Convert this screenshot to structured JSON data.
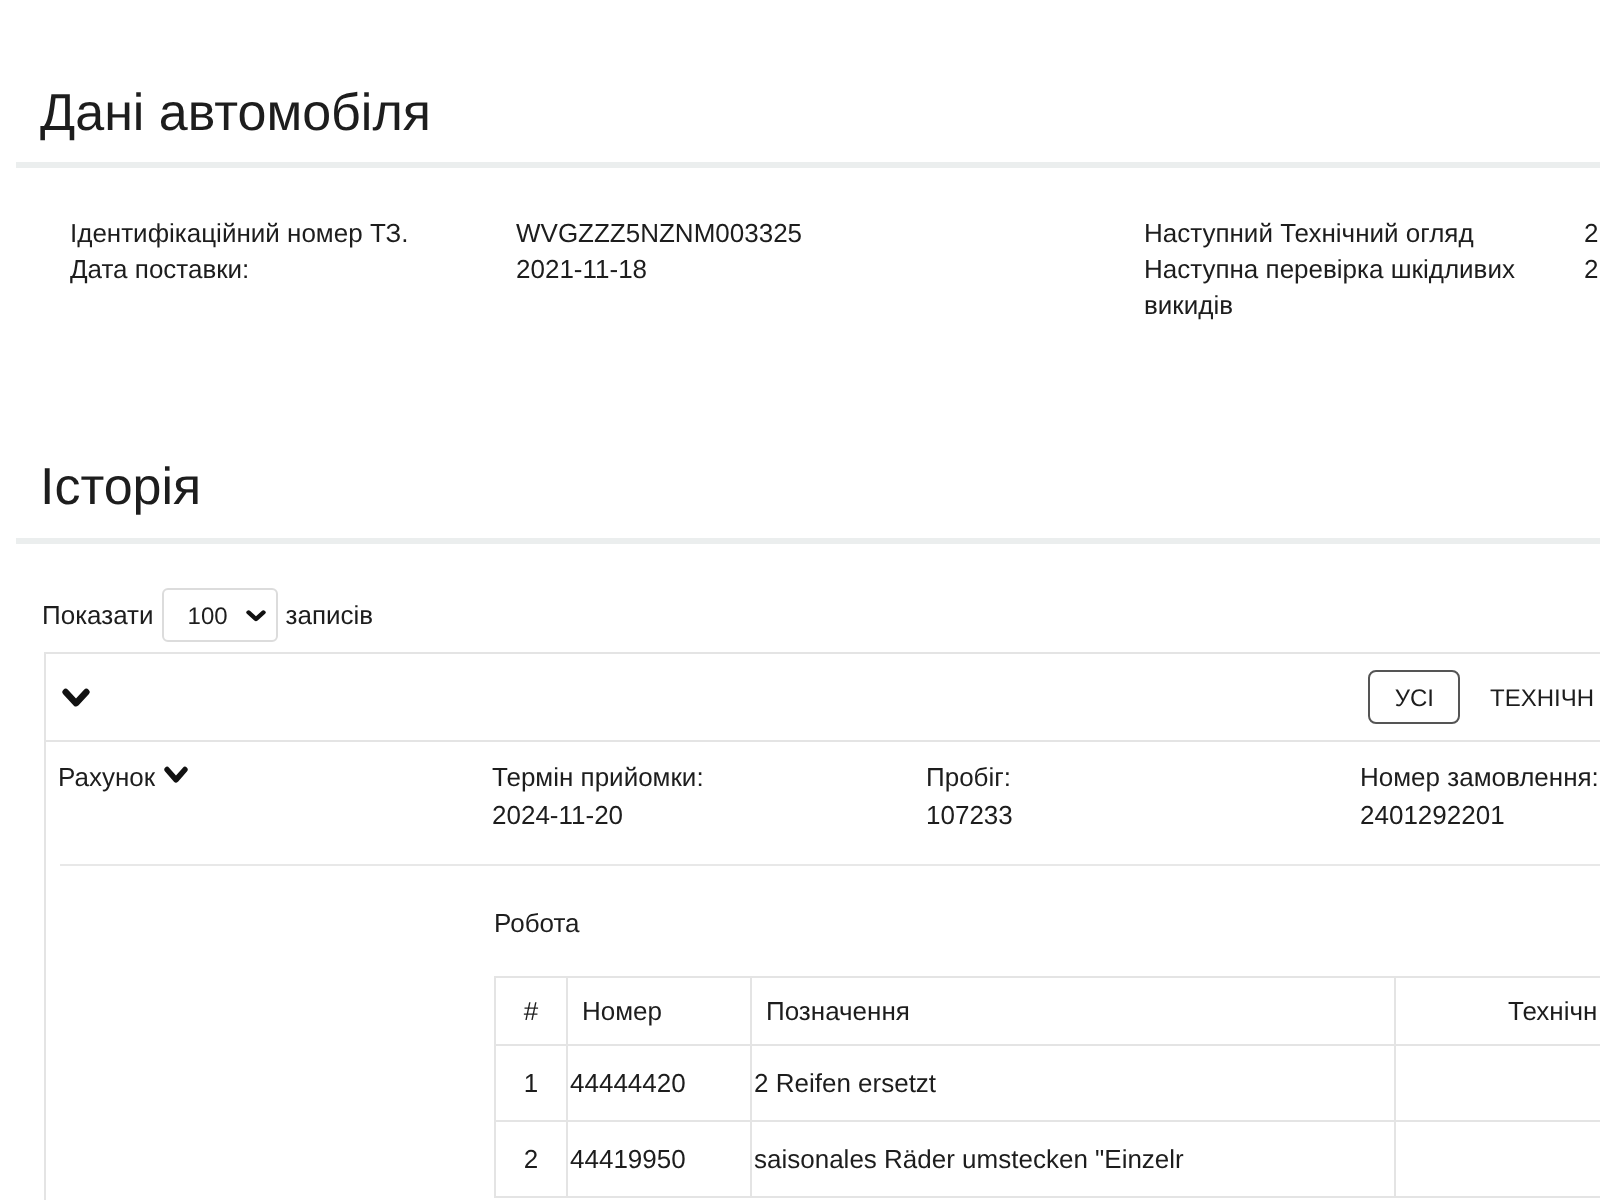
{
  "vehicle_section": {
    "title": "Дані автомобіля",
    "left_fields": [
      {
        "label": "Ідентифікаційний номер ТЗ.",
        "value": "WVGZZZ5NZNM003325"
      },
      {
        "label": "Дата поставки:",
        "value": "2021-11-18"
      }
    ],
    "right_fields": [
      {
        "label": "Наступний Технічний огляд",
        "value": "2"
      },
      {
        "label": "Наступна перевірка шкідливих викидів",
        "value": "2"
      }
    ]
  },
  "history_section": {
    "title": "Історія",
    "page_length": {
      "label_before": "Показати",
      "value": "100",
      "label_after": "записів"
    },
    "filters": [
      {
        "label": "УСІ",
        "selected": true
      },
      {
        "label": "ТЕХНІЧН",
        "selected": false
      }
    ],
    "record": {
      "heading": "Рахунок",
      "fields": [
        {
          "label": "Термін прийомки:",
          "value": "2024-11-20"
        },
        {
          "label": "Пробіг:",
          "value": "107233"
        },
        {
          "label": "Номер замовлення:",
          "value": "2401292201"
        }
      ],
      "work": {
        "title": "Робота",
        "columns": [
          "#",
          "Номер",
          "Позначення",
          "Технічн"
        ],
        "rows": [
          {
            "cells": [
              "1",
              "44444420",
              "2 Reifen ersetzt"
            ]
          },
          {
            "cells": [
              "2",
              "44419950",
              "saisonales Räder umstecken \"Einzelr"
            ]
          }
        ]
      }
    }
  }
}
